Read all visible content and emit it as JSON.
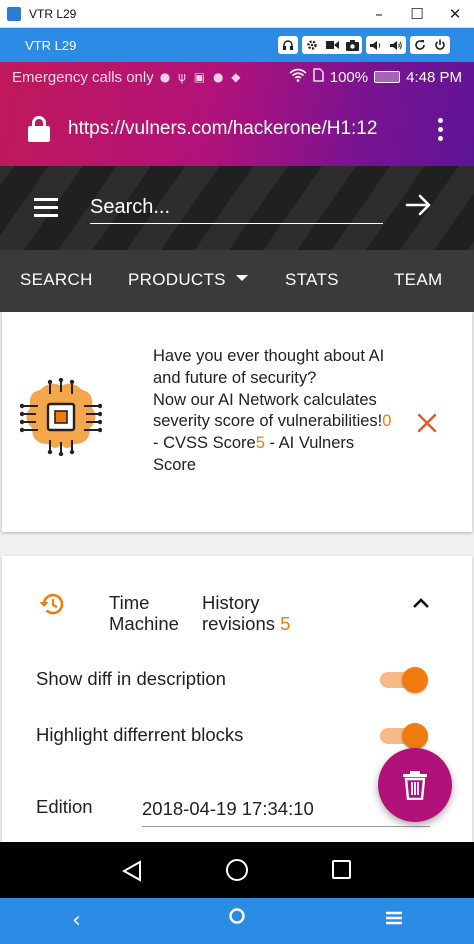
{
  "window": {
    "title": "VTR L29",
    "minimize": "–",
    "maximize": "☐",
    "close": "✕"
  },
  "emulator": {
    "label": "VTR L29"
  },
  "status_bar": {
    "left_text": "Emergency calls only",
    "battery": "100%",
    "time": "4:48 PM"
  },
  "address_bar": {
    "url": "https://vulners.com/hackerone/H1:12"
  },
  "site_header": {
    "search_placeholder": "Search..."
  },
  "nav": {
    "tabs": [
      {
        "label": "SEARCH"
      },
      {
        "label": "PRODUCTS"
      },
      {
        "label": "STATS"
      },
      {
        "label": "TEAM"
      }
    ]
  },
  "ai_banner": {
    "line1": "Have you ever thought about AI and future of security?",
    "line2": "Now our AI Network calculates severity score of vulnerabilities!",
    "cvss_score": "0",
    "cvss_label": " - CVSS Score",
    "ai_score": "5",
    "ai_label": " - AI Vulners Score"
  },
  "time_machine": {
    "title_line1": "Time",
    "title_line2": "Machine",
    "history_label_line1": "History",
    "history_label_line2": "revisions",
    "history_count": "5",
    "show_diff_label": "Show diff in description",
    "show_diff_enabled": true,
    "highlight_label": "Highlight differrent blocks",
    "highlight_enabled": true,
    "edition_label": "Edition",
    "edition_value": "2018-04-19 17:34:10"
  },
  "colors": {
    "accent_orange": "#ef7d12",
    "fab_magenta": "#b0127a",
    "emulator_blue": "#2b8be5"
  }
}
